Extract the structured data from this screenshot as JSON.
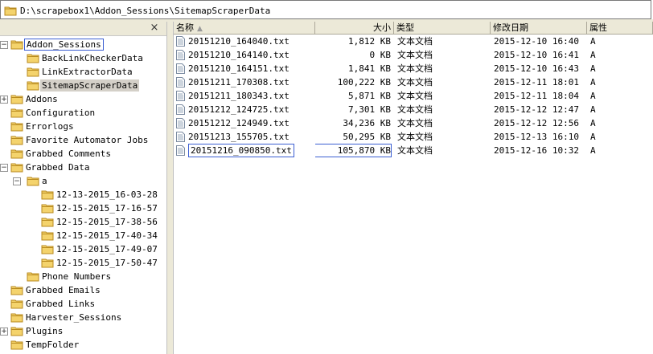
{
  "address": {
    "path": "D:\\scrapebox1\\Addon_Sessions\\SitemapScraperData"
  },
  "tree": {
    "close_label": "×",
    "nodes": [
      {
        "label": "Addon_Sessions",
        "expander": "−"
      },
      {
        "label": "BackLinkCheckerData"
      },
      {
        "label": "LinkExtractorData"
      },
      {
        "label": "SitemapScraperData"
      },
      {
        "label": "Addons",
        "expander": "+"
      },
      {
        "label": "Configuration"
      },
      {
        "label": "Errorlogs"
      },
      {
        "label": "Favorite Automator Jobs"
      },
      {
        "label": "Grabbed Comments"
      },
      {
        "label": "Grabbed Data",
        "expander": "−"
      },
      {
        "label": "a",
        "expander": "−"
      },
      {
        "label": "12-13-2015_16-03-28"
      },
      {
        "label": "12-15-2015_17-16-57"
      },
      {
        "label": "12-15-2015_17-38-56"
      },
      {
        "label": "12-15-2015_17-40-34"
      },
      {
        "label": "12-15-2015_17-49-07"
      },
      {
        "label": "12-15-2015_17-50-47"
      },
      {
        "label": "Phone Numbers"
      },
      {
        "label": "Grabbed Emails"
      },
      {
        "label": "Grabbed Links"
      },
      {
        "label": "Harvester_Sessions"
      },
      {
        "label": "Plugins",
        "expander": "+"
      },
      {
        "label": "TempFolder"
      }
    ]
  },
  "columns": {
    "name": "名称",
    "size": "大小",
    "type": "类型",
    "modified": "修改日期",
    "attr": "属性"
  },
  "files": [
    {
      "name": "20151210_164040.txt",
      "size": "1,812 KB",
      "type": "文本文档",
      "modified": "2015-12-10 16:40",
      "attr": "A"
    },
    {
      "name": "20151210_164140.txt",
      "size": "0 KB",
      "type": "文本文档",
      "modified": "2015-12-10 16:41",
      "attr": "A"
    },
    {
      "name": "20151210_164151.txt",
      "size": "1,841 KB",
      "type": "文本文档",
      "modified": "2015-12-10 16:43",
      "attr": "A"
    },
    {
      "name": "20151211_170308.txt",
      "size": "100,222 KB",
      "type": "文本文档",
      "modified": "2015-12-11 18:01",
      "attr": "A"
    },
    {
      "name": "20151211_180343.txt",
      "size": "5,871 KB",
      "type": "文本文档",
      "modified": "2015-12-11 18:04",
      "attr": "A"
    },
    {
      "name": "20151212_124725.txt",
      "size": "7,301 KB",
      "type": "文本文档",
      "modified": "2015-12-12 12:47",
      "attr": "A"
    },
    {
      "name": "20151212_124949.txt",
      "size": "34,236 KB",
      "type": "文本文档",
      "modified": "2015-12-12 12:56",
      "attr": "A"
    },
    {
      "name": "20151213_155705.txt",
      "size": "50,295 KB",
      "type": "文本文档",
      "modified": "2015-12-13 16:10",
      "attr": "A"
    },
    {
      "name": "20151216_090850.txt",
      "size": "105,870 KB",
      "type": "文本文档",
      "modified": "2015-12-16 10:32",
      "attr": "A"
    }
  ]
}
